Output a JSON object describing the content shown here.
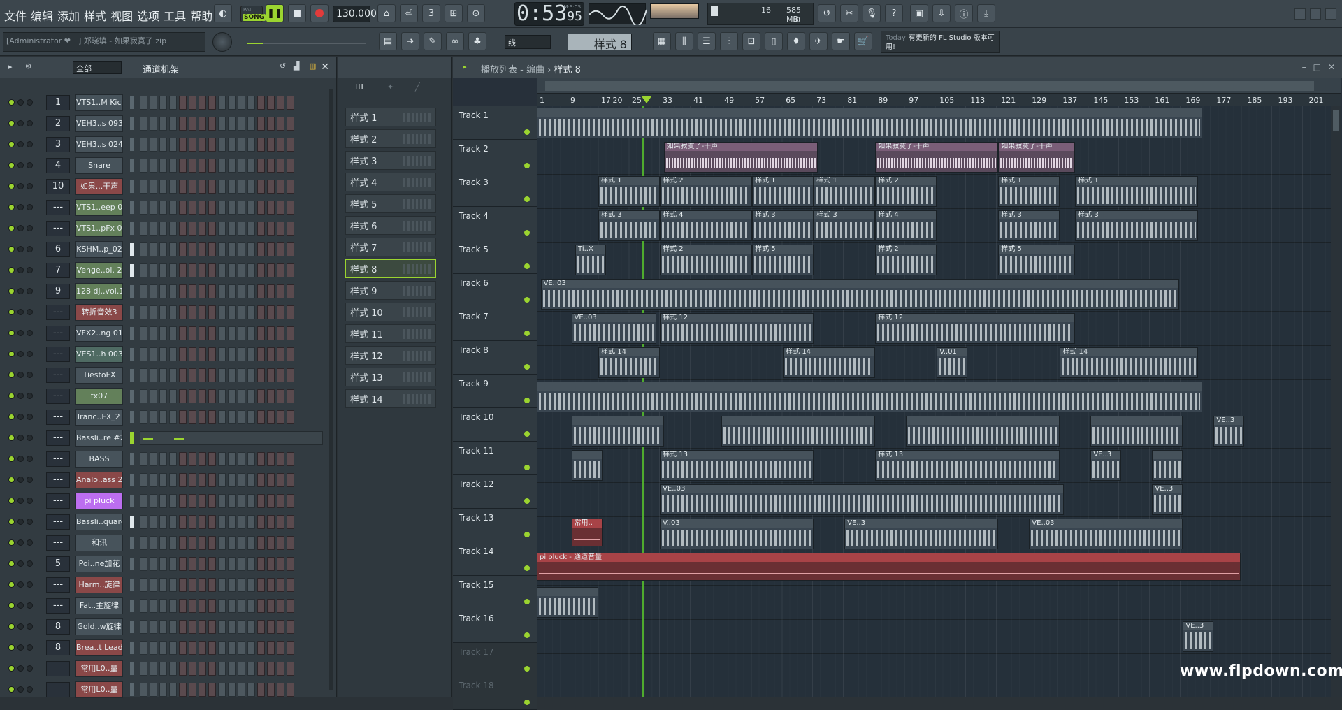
{
  "menu": [
    "文件",
    "编辑",
    "添加",
    "样式",
    "视图",
    "选项",
    "工具",
    "帮助"
  ],
  "transport": {
    "pat_label": "PAT",
    "song_label": "SONG",
    "tempo": "130.000",
    "time": "0:53",
    "time_small": "95",
    "time_unit": "M:S:CS"
  },
  "cpu": {
    "poly": "16",
    "mem": "585 MB",
    "cpu_val": "10"
  },
  "project": {
    "name": "[Administrator ❤　] 郑晓填 - 如果寂寞了.zip"
  },
  "toolbar2": {
    "snap": "线",
    "pattern": "样式 8",
    "news_today": "Today",
    "news_text": "有更新的 FL Studio 版本可用!"
  },
  "rack": {
    "filter": "全部",
    "title": "通道机架",
    "channels": [
      {
        "num": "1",
        "name": "VTS1..M Kick",
        "color": "",
        "bar": "b"
      },
      {
        "num": "2",
        "name": "VEH3..s 093",
        "color": "",
        "bar": "b"
      },
      {
        "num": "3",
        "name": "VEH3..s 024",
        "color": "",
        "bar": "b"
      },
      {
        "num": "4",
        "name": "Snare",
        "color": "",
        "bar": "b"
      },
      {
        "num": "10",
        "name": "如果...干声",
        "color": "red",
        "bar": "b"
      },
      {
        "num": "---",
        "name": "VTS1..eep 01",
        "color": "green",
        "bar": "b"
      },
      {
        "num": "---",
        "name": "VTS1..pFx 03",
        "color": "green",
        "bar": "b"
      },
      {
        "num": "6",
        "name": "KSHM..p_02",
        "color": "",
        "bar": "w"
      },
      {
        "num": "7",
        "name": "Venge..ol. 2",
        "color": "green",
        "bar": "w"
      },
      {
        "num": "9",
        "name": "128 dj..vol.1",
        "color": "green",
        "bar": "b"
      },
      {
        "num": "---",
        "name": "转折音效3",
        "color": "red",
        "bar": "b"
      },
      {
        "num": "---",
        "name": "VFX2..ng 01",
        "color": "",
        "bar": "b"
      },
      {
        "num": "---",
        "name": "VES1..h 003",
        "color": "teal",
        "bar": "b"
      },
      {
        "num": "---",
        "name": "TiestoFX",
        "color": "",
        "bar": "b"
      },
      {
        "num": "---",
        "name": "fx07",
        "color": "green",
        "bar": "b"
      },
      {
        "num": "---",
        "name": "Tranc..FX_27",
        "color": "",
        "bar": "b"
      },
      {
        "num": "---",
        "name": "Bassli..re #2",
        "color": "",
        "bar": "g"
      },
      {
        "num": "---",
        "name": "BASS",
        "color": "",
        "bar": "b"
      },
      {
        "num": "---",
        "name": "Analo..ass 2",
        "color": "red",
        "bar": "b"
      },
      {
        "num": "---",
        "name": "pi pluck",
        "color": "pink",
        "bar": "b"
      },
      {
        "num": "---",
        "name": "Bassli..quare",
        "color": "",
        "bar": "w"
      },
      {
        "num": "---",
        "name": "和讯",
        "color": "",
        "bar": "b"
      },
      {
        "num": "5",
        "name": "Poi..ne加花",
        "color": "",
        "bar": "b"
      },
      {
        "num": "---",
        "name": "Harm..旋律",
        "color": "red",
        "bar": "b"
      },
      {
        "num": "---",
        "name": "Fat..主旋律",
        "color": "",
        "bar": "b"
      },
      {
        "num": "8",
        "name": "Gold..w旋律",
        "color": "",
        "bar": "b"
      },
      {
        "num": "8",
        "name": "Brea..t Lead",
        "color": "red",
        "bar": "b"
      },
      {
        "num": "",
        "name": "常用L0..量",
        "color": "red",
        "bar": "b"
      },
      {
        "num": "",
        "name": "常用L0..量",
        "color": "red",
        "bar": "b"
      }
    ]
  },
  "patterns": [
    "样式 1",
    "样式 2",
    "样式 3",
    "样式 4",
    "样式 5",
    "样式 6",
    "样式 7",
    "样式 8",
    "样式 9",
    "样式 10",
    "样式 11",
    "样式 12",
    "样式 13",
    "样式 14"
  ],
  "selected_pattern": "样式 8",
  "playlist": {
    "title_prefix": "播放列表 - 编曲",
    "title_pattern": "样式 8",
    "ruler": [
      "1",
      "9",
      "17",
      "25",
      "33",
      "41",
      "49",
      "57",
      "65",
      "73",
      "81",
      "89",
      "97",
      "105",
      "113",
      "121",
      "129",
      "137",
      "145",
      "153",
      "161",
      "169",
      "177",
      "185",
      "193",
      "201",
      "20"
    ],
    "tracks": [
      "Track 1",
      "Track 2",
      "Track 3",
      "Track 4",
      "Track 5",
      "Track 6",
      "Track 7",
      "Track 8",
      "Track 9",
      "Track 10",
      "Track 11",
      "Track 12",
      "Track 13",
      "Track 14",
      "Track 15",
      "Track 16",
      "Track 17",
      "Track 18"
    ],
    "clips": [
      {
        "track": 1,
        "start": 1,
        "len": 173,
        "label": "",
        "kind": "notes"
      },
      {
        "track": 2,
        "start": 34,
        "len": 40,
        "label": "如果寂寞了-干声",
        "kind": "audio"
      },
      {
        "track": 2,
        "start": 89,
        "len": 32,
        "label": "如果寂寞了-干声",
        "kind": "audio"
      },
      {
        "track": 2,
        "start": 121,
        "len": 20,
        "label": "如果寂寞了-干声",
        "kind": "audio"
      },
      {
        "track": 3,
        "start": 17,
        "len": 16,
        "label": "样式 1",
        "kind": "notes"
      },
      {
        "track": 3,
        "start": 33,
        "len": 24,
        "label": "样式 2",
        "kind": "notes"
      },
      {
        "track": 3,
        "start": 57,
        "len": 16,
        "label": "样式 1",
        "kind": "notes"
      },
      {
        "track": 3,
        "start": 73,
        "len": 16,
        "label": "样式 1",
        "kind": "notes"
      },
      {
        "track": 3,
        "start": 89,
        "len": 16,
        "label": "样式 2",
        "kind": "notes"
      },
      {
        "track": 3,
        "start": 121,
        "len": 16,
        "label": "样式 1",
        "kind": "notes"
      },
      {
        "track": 3,
        "start": 141,
        "len": 32,
        "label": "样式 1",
        "kind": "notes"
      },
      {
        "track": 4,
        "start": 17,
        "len": 16,
        "label": "样式 3",
        "kind": "notes"
      },
      {
        "track": 4,
        "start": 33,
        "len": 24,
        "label": "样式 4",
        "kind": "notes"
      },
      {
        "track": 4,
        "start": 57,
        "len": 16,
        "label": "样式 3",
        "kind": "notes"
      },
      {
        "track": 4,
        "start": 73,
        "len": 16,
        "label": "样式 3",
        "kind": "notes"
      },
      {
        "track": 4,
        "start": 89,
        "len": 16,
        "label": "样式 4",
        "kind": "notes"
      },
      {
        "track": 4,
        "start": 121,
        "len": 16,
        "label": "样式 3",
        "kind": "notes"
      },
      {
        "track": 4,
        "start": 141,
        "len": 32,
        "label": "样式 3",
        "kind": "notes"
      },
      {
        "track": 5,
        "start": 11,
        "len": 8,
        "label": "Ti..X",
        "kind": "notes"
      },
      {
        "track": 5,
        "start": 33,
        "len": 24,
        "label": "样式 2",
        "kind": "notes"
      },
      {
        "track": 5,
        "start": 57,
        "len": 16,
        "label": "样式 5",
        "kind": "notes"
      },
      {
        "track": 5,
        "start": 89,
        "len": 16,
        "label": "样式 2",
        "kind": "notes"
      },
      {
        "track": 5,
        "start": 121,
        "len": 20,
        "label": "样式 5",
        "kind": "notes"
      },
      {
        "track": 6,
        "start": 2,
        "len": 166,
        "label": "VE..03",
        "kind": "notes"
      },
      {
        "track": 7,
        "start": 10,
        "len": 22,
        "label": "VE..03",
        "kind": "notes"
      },
      {
        "track": 7,
        "start": 33,
        "len": 40,
        "label": "样式 12",
        "kind": "notes"
      },
      {
        "track": 7,
        "start": 89,
        "len": 52,
        "label": "样式 12",
        "kind": "notes"
      },
      {
        "track": 8,
        "start": 17,
        "len": 16,
        "label": "样式 14",
        "kind": "notes"
      },
      {
        "track": 8,
        "start": 65,
        "len": 24,
        "label": "样式 14",
        "kind": "notes"
      },
      {
        "track": 8,
        "start": 105,
        "len": 8,
        "label": "V..01",
        "kind": "notes"
      },
      {
        "track": 8,
        "start": 137,
        "len": 36,
        "label": "样式 14",
        "kind": "notes"
      },
      {
        "track": 9,
        "start": 1,
        "len": 173,
        "label": "",
        "kind": "notes"
      },
      {
        "track": 10,
        "start": 10,
        "len": 24,
        "label": "",
        "kind": "notes"
      },
      {
        "track": 10,
        "start": 49,
        "len": 40,
        "label": "",
        "kind": "notes"
      },
      {
        "track": 10,
        "start": 97,
        "len": 40,
        "label": "",
        "kind": "notes"
      },
      {
        "track": 10,
        "start": 145,
        "len": 24,
        "label": "",
        "kind": "notes"
      },
      {
        "track": 10,
        "start": 177,
        "len": 8,
        "label": "VE..3",
        "kind": "notes"
      },
      {
        "track": 11,
        "start": 10,
        "len": 8,
        "label": "",
        "kind": "notes"
      },
      {
        "track": 11,
        "start": 33,
        "len": 40,
        "label": "样式 13",
        "kind": "notes"
      },
      {
        "track": 11,
        "start": 89,
        "len": 48,
        "label": "样式 13",
        "kind": "notes"
      },
      {
        "track": 11,
        "start": 145,
        "len": 8,
        "label": "VE..3",
        "kind": "notes"
      },
      {
        "track": 11,
        "start": 161,
        "len": 8,
        "label": "",
        "kind": "notes"
      },
      {
        "track": 12,
        "start": 33,
        "len": 105,
        "label": "VE..03",
        "kind": "notes"
      },
      {
        "track": 12,
        "start": 161,
        "len": 8,
        "label": "VE..3",
        "kind": "notes"
      },
      {
        "track": 13,
        "start": 10,
        "len": 8,
        "label": "常用..",
        "kind": "auto"
      },
      {
        "track": 13,
        "start": 33,
        "len": 40,
        "label": "V..03",
        "kind": "notes"
      },
      {
        "track": 13,
        "start": 81,
        "len": 40,
        "label": "VE..3",
        "kind": "notes"
      },
      {
        "track": 13,
        "start": 129,
        "len": 40,
        "label": "VE..03",
        "kind": "notes"
      },
      {
        "track": 14,
        "start": 1,
        "len": 183,
        "label": "pi pluck - 通道音量",
        "kind": "auto"
      },
      {
        "track": 15,
        "start": 1,
        "len": 16,
        "label": "",
        "kind": "notes"
      },
      {
        "track": 16,
        "start": 169,
        "len": 8,
        "label": "VE..3",
        "kind": "notes"
      }
    ]
  },
  "watermark": "www.flpdown.com"
}
